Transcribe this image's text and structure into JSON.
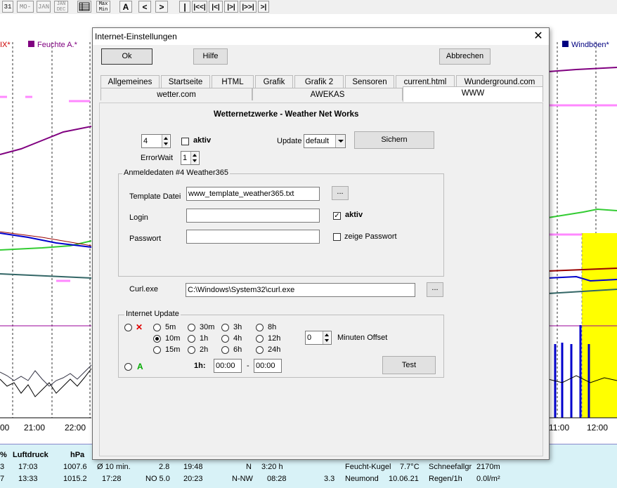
{
  "toolbar": {
    "buttons": [
      "31",
      "MO-SU",
      "JAN",
      "JAN DEC",
      "",
      "Max Min",
      "A",
      "<",
      ">",
      "|",
      "|<<|",
      "|<|",
      "|>|",
      "|>>|",
      ">|"
    ]
  },
  "chart": {
    "legend_left": "IX*",
    "legend_mid": "Feuchte A.*",
    "legend_right": "Windböen*",
    "colors": {
      "humidity": "#800080",
      "gust": "#000080",
      "yellow": "#ffff00",
      "green": "#33cc33",
      "pink": "#ff88ff",
      "blue": "#0000cc"
    },
    "time_labels": [
      "00",
      "21:00",
      "22:00",
      "11:00",
      "12:00"
    ]
  },
  "datatable": {
    "row0": [
      "%",
      "Luftdruck",
      "hPa"
    ],
    "row1": [
      "3",
      "17:03",
      "1007.6",
      "Ø 10 min.",
      "2.8",
      "19:48",
      "N",
      "3:20 h",
      "Feucht-Kugel",
      "7.7°C",
      "Schneefallgr",
      "2170m"
    ],
    "row2": [
      "7",
      "13:33",
      "1015.2",
      "17:28",
      "NO 5.0",
      "20:23",
      "N-NW",
      "08:28",
      "3.3",
      "Neumond",
      "10.06.21",
      "Regen/1h",
      "0.0l/m²"
    ]
  },
  "dialog": {
    "title": "Internet-Einstellungen",
    "close_icon": "✕",
    "ok_label": "Ok",
    "help_label": "Hilfe",
    "cancel_label": "Abbrechen",
    "tabs_row1": [
      "Allgemeines",
      "Startseite",
      "HTML",
      "Grafik",
      "Grafik 2",
      "Sensoren",
      "current.html",
      "Wunderground.com"
    ],
    "tabs_row2": [
      "wetter.com",
      "AWEKAS",
      "WWW"
    ],
    "active_tab": "WWW",
    "panel_title": "Wetternetzwerke - Weather Net Works",
    "index_value": "4",
    "aktiv_label": "aktiv",
    "update_label": "Update",
    "update_value": "default",
    "sichern_label": "Sichern",
    "errorwait_label": "ErrorWait",
    "errorwait_value": "1",
    "login_group_title": "Anmeldedaten #4  Weather365",
    "template_label": "Template Datei",
    "template_value": "www_template_weather365.txt",
    "browse_label": "...",
    "login_label": "Login",
    "login_value": "",
    "login_aktiv_label": "aktiv",
    "password_label": "Passwort",
    "password_value": "",
    "show_password_label": "zeige Passwort",
    "curl_label": "Curl.exe",
    "curl_value": "C:\\Windows\\System32\\curl.exe",
    "curl_browse_label": "...",
    "update_group_title": "Internet Update",
    "off_mark": "✕",
    "auto_mark": "A",
    "intervals": [
      "5m",
      "30m",
      "3h",
      "8h",
      "10m",
      "1h",
      "4h",
      "12h",
      "15m",
      "2h",
      "6h",
      "24h"
    ],
    "selected_interval": "10m",
    "offset_value": "0",
    "offset_label": "Minuten Offset",
    "hour_label": "1h:",
    "from_value": "00:00",
    "dash": "-",
    "to_value": "00:00",
    "test_label": "Test"
  }
}
